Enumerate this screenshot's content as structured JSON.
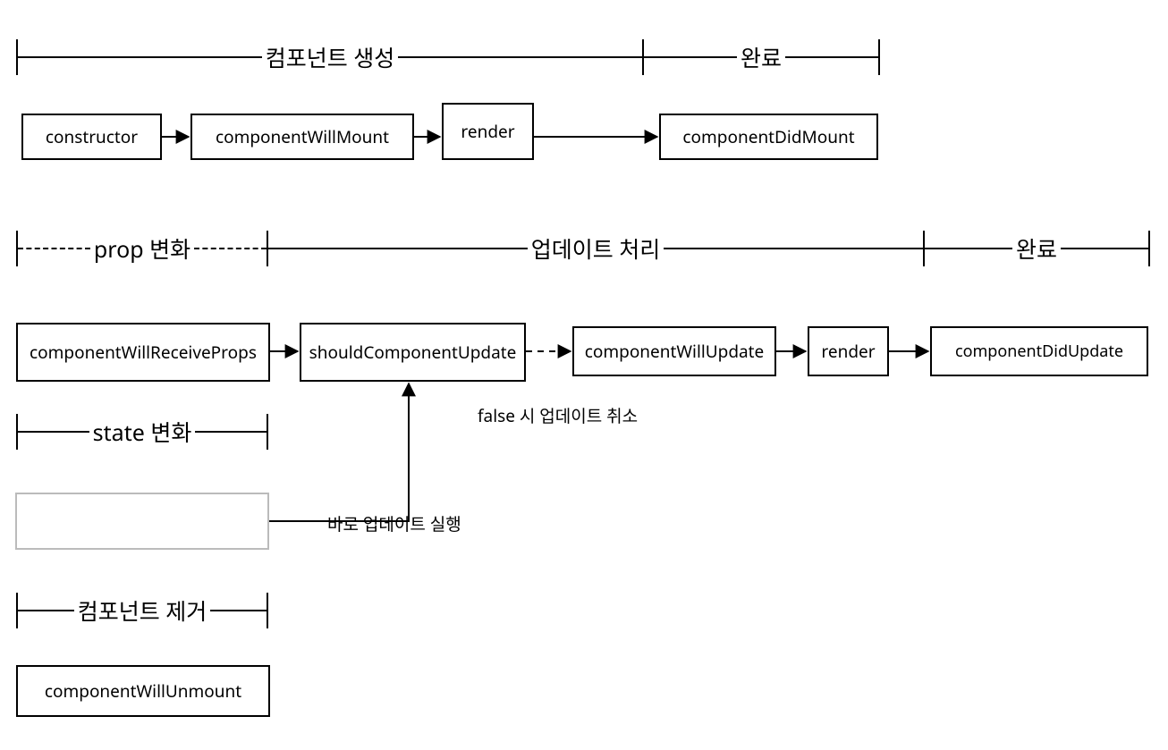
{
  "spans": {
    "create": "컴포넌트 생성",
    "done1": "완료",
    "prop": "prop 변화",
    "update": "업데이트 처리",
    "done2": "완료",
    "state": "state 변화",
    "remove": "컴포넌트 제거"
  },
  "boxes": {
    "constructor": "constructor",
    "cwm": "componentWillMount",
    "render1": "render",
    "cdm": "componentDidMount",
    "cwrp": "componentWillReceiveProps",
    "scu": "shouldComponentUpdate",
    "cwu": "componentWillUpdate",
    "render2": "render",
    "cdu": "componentDidUpdate",
    "cwunm": "componentWillUnmount"
  },
  "notes": {
    "falseCancel": "false 시 업데이트 취소",
    "directUpdate": "바로 업데이트 실행"
  }
}
